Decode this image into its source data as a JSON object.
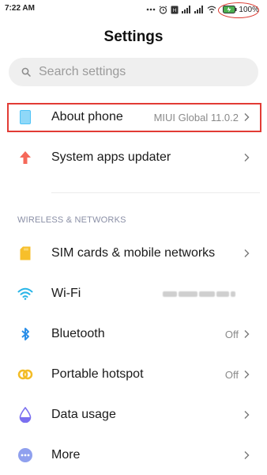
{
  "status": {
    "time": "7:22 AM",
    "battery": "100%",
    "icons": [
      "more-dots-icon",
      "alarm-icon",
      "sim-icon",
      "signal-icon",
      "signal-icon",
      "wifi-icon",
      "battery-charging-icon"
    ]
  },
  "page": {
    "title": "Settings"
  },
  "search": {
    "placeholder": "Search settings"
  },
  "items": {
    "about": {
      "label": "About phone",
      "value": "MIUI Global 11.0.2",
      "icon": "phone-icon",
      "color": "#4fc3f7"
    },
    "updater": {
      "label": "System apps updater",
      "icon": "arrow-up-icon",
      "color": "#f5685a"
    },
    "sim": {
      "label": "SIM cards & mobile networks",
      "icon": "sim-card-icon",
      "color": "#f7bf2b"
    },
    "wifi": {
      "label": "Wi-Fi",
      "icon": "wifi-icon",
      "color": "#29b6e8"
    },
    "bluetooth": {
      "label": "Bluetooth",
      "value": "Off",
      "icon": "bluetooth-icon",
      "color": "#2b8fe8"
    },
    "hotspot": {
      "label": "Portable hotspot",
      "value": "Off",
      "icon": "hotspot-icon",
      "color": "#f3bc26"
    },
    "data": {
      "label": "Data usage",
      "icon": "drop-icon",
      "color": "#7a6ff0"
    },
    "more": {
      "label": "More",
      "icon": "more-icon",
      "color": "#7b8fe8"
    }
  },
  "sections": {
    "wireless": "WIRELESS & NETWORKS"
  },
  "colors": {
    "highlight": "#e23b35",
    "accent": "#4fc3f7"
  }
}
